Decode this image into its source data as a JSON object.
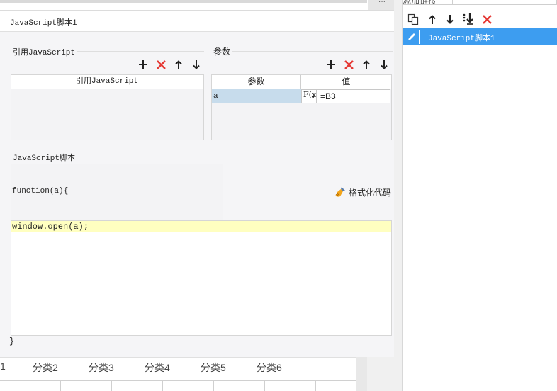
{
  "top_bar": {
    "dots": "···"
  },
  "dialog": {
    "title": "JavaScript脚本1",
    "ref_section": {
      "label": "引用JavaScript",
      "column_header": "引用JavaScript"
    },
    "param_section": {
      "label": "参数",
      "columns": [
        "参数",
        "值"
      ],
      "rows": [
        {
          "name": "a",
          "fx": "F(x)",
          "value": "=B3"
        }
      ]
    },
    "script_section": {
      "label": "JavaScript脚本",
      "signature": "function(a){",
      "format_label": "格式化代码",
      "code_line": "window.open(a);",
      "closing": "}"
    }
  },
  "category_tabs": [
    "1",
    "分类2",
    "分类3",
    "分类4",
    "分类5",
    "分类6"
  ],
  "right_panel": {
    "tab_label": "添加链接",
    "links": [
      {
        "label": "JavaScript脚本1"
      }
    ]
  },
  "colors": {
    "accent": "#3d9df0",
    "delete_red": "#e53935",
    "code_highlight": "#ffffc0",
    "selected_cell": "#c7dcec"
  },
  "icons": {
    "toolbar": [
      "add-icon",
      "delete-icon",
      "arrow-up-icon",
      "arrow-down-icon"
    ],
    "right_toolbar": [
      "copy-icon",
      "arrow-up-icon",
      "arrow-down-icon",
      "move-to-bottom-icon",
      "delete-icon"
    ],
    "link_item": "pencil-icon",
    "format": "broom-icon"
  }
}
